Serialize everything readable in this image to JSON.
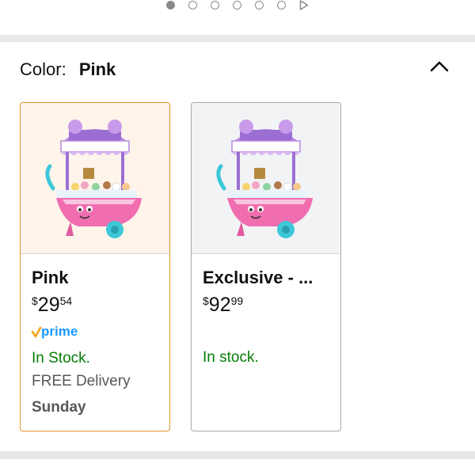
{
  "carousel": {
    "dot_count": 6,
    "active_index": 0,
    "play_icon": "play-icon"
  },
  "color_selector": {
    "label": "Color:",
    "selected_value": "Pink",
    "collapse_icon": "chevron-up-icon"
  },
  "options": [
    {
      "title": "Pink",
      "price_symbol": "$",
      "price_whole": "29",
      "price_fraction": "54",
      "prime_label": "prime",
      "stock": "In Stock.",
      "delivery": "FREE Delivery",
      "delivery_day": "Sunday",
      "image": "ice-cream-cart-toy-image"
    },
    {
      "title": "Exclusive - ...",
      "price_symbol": "$",
      "price_whole": "92",
      "price_fraction": "99",
      "stock": "In stock.",
      "image": "ice-cream-cart-toy-image"
    }
  ],
  "colors": {
    "selected_border": "#e2912e",
    "unselected_border": "#a6a9ad",
    "stock_green": "#067d06",
    "prime_blue": "#1a98ff",
    "prime_check": "#f7a31c",
    "divider": "#e8e8ea"
  }
}
